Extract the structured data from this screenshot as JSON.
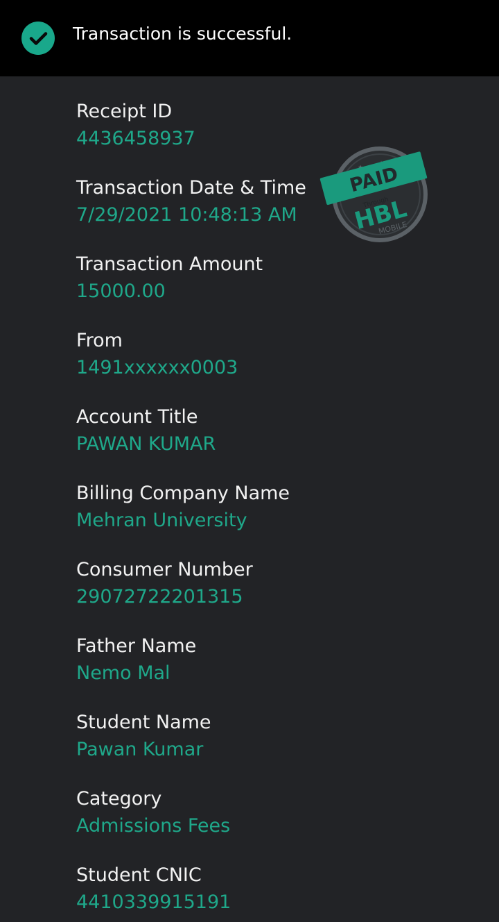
{
  "banner": {
    "message": "Transaction is successful.",
    "icon": "check-circle-icon",
    "accent_color": "#19a88b"
  },
  "stamp": {
    "paid": "PAID",
    "through": "Through",
    "brand": "HBL",
    "mobile": "MOBILE"
  },
  "receipt": {
    "fields": [
      {
        "label": "Receipt ID",
        "value": "4436458937"
      },
      {
        "label": "Transaction Date & Time",
        "value": "7/29/2021 10:48:13 AM"
      },
      {
        "label": "Transaction Amount",
        "value": "15000.00"
      },
      {
        "label": "From",
        "value": "1491xxxxxx0003"
      },
      {
        "label": "Account Title",
        "value": "PAWAN KUMAR"
      },
      {
        "label": "Billing Company Name",
        "value": "Mehran University"
      },
      {
        "label": "Consumer Number",
        "value": "29072722201315"
      },
      {
        "label": "Father Name",
        "value": "Nemo Mal"
      },
      {
        "label": "Student Name",
        "value": "Pawan Kumar"
      },
      {
        "label": "Category",
        "value": "Admissions Fees"
      },
      {
        "label": "Student CNIC",
        "value": "4410339915191"
      }
    ],
    "label_color": "#f2f2f2",
    "value_color": "#1fa88a"
  }
}
